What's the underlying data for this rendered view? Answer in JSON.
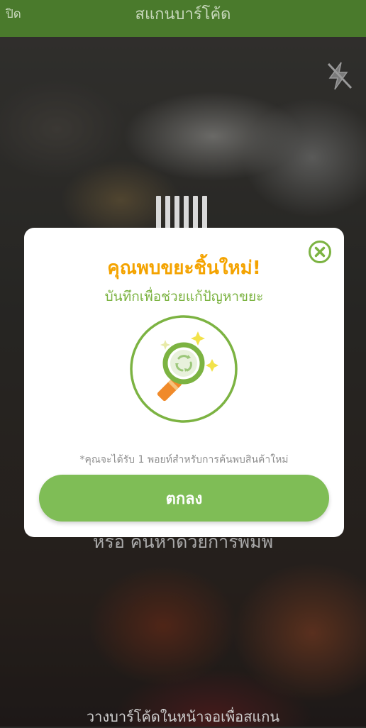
{
  "topbar": {
    "close_label": "ปิด",
    "title": "สแกนบาร์โค้ด"
  },
  "camera": {
    "flash_icon": "flash-off-icon",
    "manual_search_text": "หรือ ค้นหาด้วยการพิมพ์",
    "scan_hint": "วางบาร์โค้ดในหน้าจอเพื่อสแกน"
  },
  "modal": {
    "title": "คุณพบขยะชิ้นใหม่!",
    "subtitle": "บันทึกเพื่อช่วยแก้ปัญหาขยะ",
    "illustration_icon": "recycle-magnifier-icon",
    "note": "*คุณจะได้รับ 1 พอยท์สำหรับการค้นพบสินค้าใหม่",
    "ok_label": "ตกลง",
    "close_icon": "close-circle-icon"
  },
  "colors": {
    "topbar": "#4a7a2c",
    "accent_orange": "#f4a300",
    "accent_green": "#7cb342",
    "button_green": "#7fbd56"
  }
}
